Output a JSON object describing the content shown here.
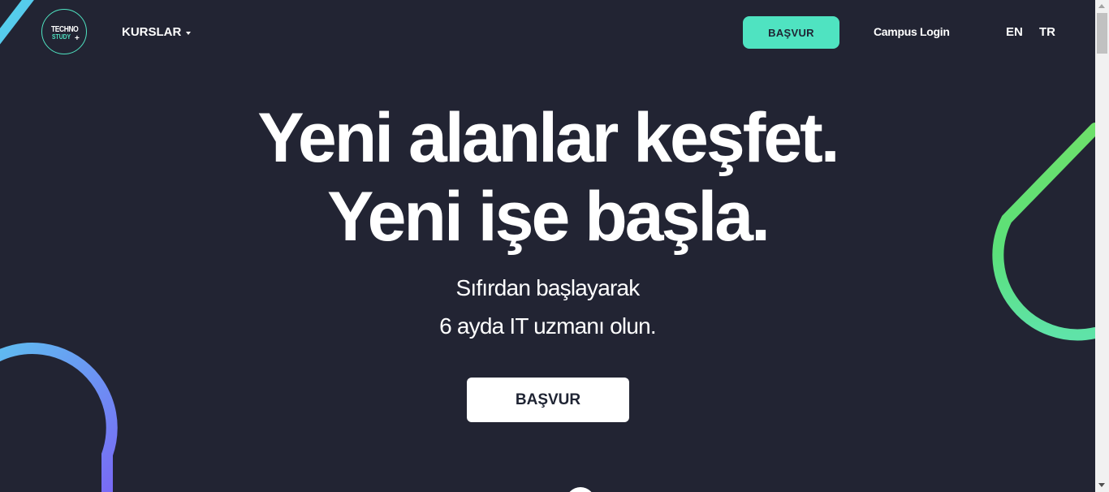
{
  "header": {
    "logo": {
      "line1": "TECHNO",
      "line2": "STUDY",
      "plus": "+"
    },
    "courses_label": "KURSLAR",
    "apply_label": "BAŞVUR",
    "campus_login_label": "Campus Login",
    "languages": [
      "EN",
      "TR"
    ]
  },
  "hero": {
    "headline_line1": "Yeni alanlar keşfet.",
    "headline_line2": "Yeni işe başla.",
    "subtitle_line1": "Sıfırdan başlayarak",
    "subtitle_line2": "6 ayda IT uzmanı olun.",
    "apply_button_label": "BAŞVUR"
  },
  "colors": {
    "background": "#222433",
    "accent": "#4fe3c1",
    "text": "#ffffff",
    "green_arc": "#5be07a",
    "blue_arc": "#6c7cf5"
  },
  "icons": {
    "dropdown": "caret-down-icon"
  }
}
